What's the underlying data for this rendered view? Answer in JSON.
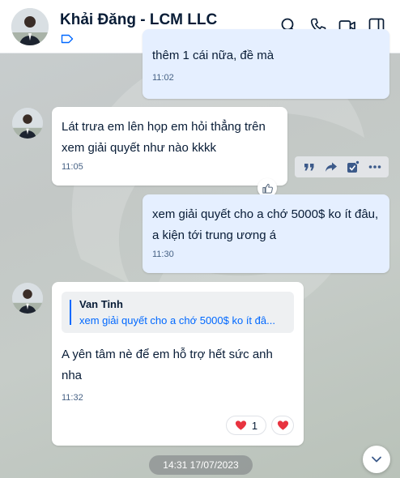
{
  "header": {
    "title": "Khải Đăng - LCM LLC",
    "icons": [
      "search-icon",
      "phone-icon",
      "video-icon",
      "sidebar-toggle-icon"
    ]
  },
  "messages": [
    {
      "side": "mine",
      "text": "thêm 1 cái nữa, đề mà",
      "time": "11:02"
    },
    {
      "side": "theirs",
      "text": "Lát trưa em lên họp em hỏi thẳng trên\nxem giải quyết như nào kkkk",
      "time": "11:05"
    },
    {
      "side": "mine",
      "text": "xem giải quyết cho a chớ 5000$ ko ít đâu,\na kiện tới trung ương á",
      "time": "11:30"
    },
    {
      "side": "theirs",
      "quote": {
        "author": "Van Tinh",
        "text": "xem giải quyết cho a chớ 5000$ ko ít đâ..."
      },
      "text": "A yên tâm nè để em hỗ trợ hết sức anh\nnha",
      "time": "11:32",
      "reaction_count": "1"
    }
  ],
  "message_actions": [
    "quote-icon",
    "forward-icon",
    "task-icon",
    "more-icon"
  ],
  "date_divider": "14:31 17/07/2023",
  "colors": {
    "mine_bubble": "#e5efff",
    "theirs_bubble": "#ffffff",
    "accent": "#0068ff",
    "heart": "#e8333f"
  }
}
